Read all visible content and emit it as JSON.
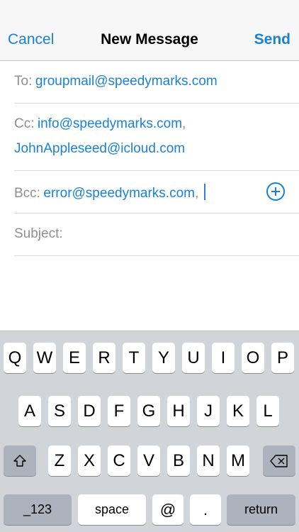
{
  "nav": {
    "cancel": "Cancel",
    "title": "New Message",
    "send": "Send"
  },
  "fields": {
    "to": {
      "label": "To:",
      "value": "groupmail@speedymarks.com"
    },
    "cc": {
      "label": "Cc:",
      "value1": "info@speedymarks.com",
      "separator": ",",
      "value2": "JohnAppleseed@icloud.com"
    },
    "bcc": {
      "label": "Bcc:",
      "value": "error@speedymarks.com",
      "separator": ","
    },
    "subject": {
      "label": "Subject:"
    }
  },
  "keyboard": {
    "row1": [
      "Q",
      "W",
      "E",
      "R",
      "T",
      "Y",
      "U",
      "I",
      "O",
      "P"
    ],
    "row2": [
      "A",
      "S",
      "D",
      "F",
      "G",
      "H",
      "J",
      "K",
      "L"
    ],
    "row3": [
      "Z",
      "X",
      "C",
      "V",
      "B",
      "N",
      "M"
    ],
    "numbers_key": "_123",
    "space_key": "space",
    "at_key": "@",
    "period_key": ".",
    "return_key": "return",
    "shift_icon": "shift-icon",
    "delete_icon": "delete-icon"
  }
}
